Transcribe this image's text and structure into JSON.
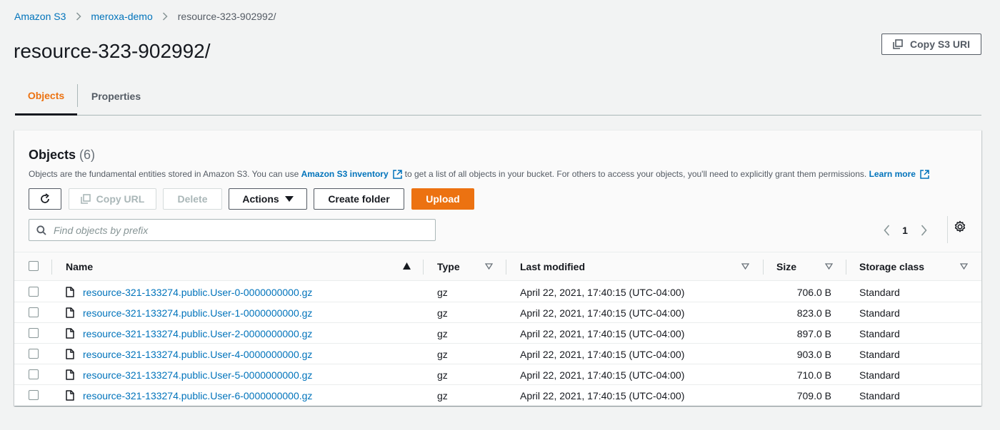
{
  "breadcrumb": {
    "items": [
      "Amazon S3",
      "meroxa-demo",
      "resource-323-902992/"
    ]
  },
  "page": {
    "title": "resource-323-902992/",
    "copy_uri_label": "Copy S3 URI"
  },
  "tabs": [
    {
      "label": "Objects",
      "active": true
    },
    {
      "label": "Properties",
      "active": false
    }
  ],
  "objects_panel": {
    "title": "Objects",
    "count": "(6)",
    "description_pre": "Objects are the fundamental entities stored in Amazon S3. You can use",
    "inventory_link": "Amazon S3 inventory",
    "description_post": "to get a list of all objects in your bucket. For others to access your objects, you'll need to explicitly grant them permissions.",
    "learn_more": "Learn more",
    "buttons": {
      "copy_url": "Copy URL",
      "delete": "Delete",
      "actions": "Actions",
      "create_folder": "Create folder",
      "upload": "Upload"
    },
    "search_placeholder": "Find objects by prefix",
    "page_number": "1"
  },
  "table": {
    "columns": [
      "Name",
      "Type",
      "Last modified",
      "Size",
      "Storage class"
    ],
    "rows": [
      {
        "name": "resource-321-133274.public.User-0-0000000000.gz",
        "type": "gz",
        "modified": "April 22, 2021, 17:40:15 (UTC-04:00)",
        "size": "706.0 B",
        "storage": "Standard"
      },
      {
        "name": "resource-321-133274.public.User-1-0000000000.gz",
        "type": "gz",
        "modified": "April 22, 2021, 17:40:15 (UTC-04:00)",
        "size": "823.0 B",
        "storage": "Standard"
      },
      {
        "name": "resource-321-133274.public.User-2-0000000000.gz",
        "type": "gz",
        "modified": "April 22, 2021, 17:40:15 (UTC-04:00)",
        "size": "897.0 B",
        "storage": "Standard"
      },
      {
        "name": "resource-321-133274.public.User-4-0000000000.gz",
        "type": "gz",
        "modified": "April 22, 2021, 17:40:15 (UTC-04:00)",
        "size": "903.0 B",
        "storage": "Standard"
      },
      {
        "name": "resource-321-133274.public.User-5-0000000000.gz",
        "type": "gz",
        "modified": "April 22, 2021, 17:40:15 (UTC-04:00)",
        "size": "710.0 B",
        "storage": "Standard"
      },
      {
        "name": "resource-321-133274.public.User-6-0000000000.gz",
        "type": "gz",
        "modified": "April 22, 2021, 17:40:15 (UTC-04:00)",
        "size": "709.0 B",
        "storage": "Standard"
      }
    ]
  },
  "colors": {
    "accent": "#ec7211",
    "link": "#0073bb",
    "text": "#16191f",
    "background": "#f2f3f3"
  },
  "icons": [
    "chevron-right-icon",
    "copy-icon",
    "refresh-icon",
    "caret-down-icon",
    "external-link-icon",
    "search-icon",
    "chevron-left-icon",
    "settings-icon",
    "sort-ascending-icon",
    "sort-icon",
    "file-icon"
  ]
}
